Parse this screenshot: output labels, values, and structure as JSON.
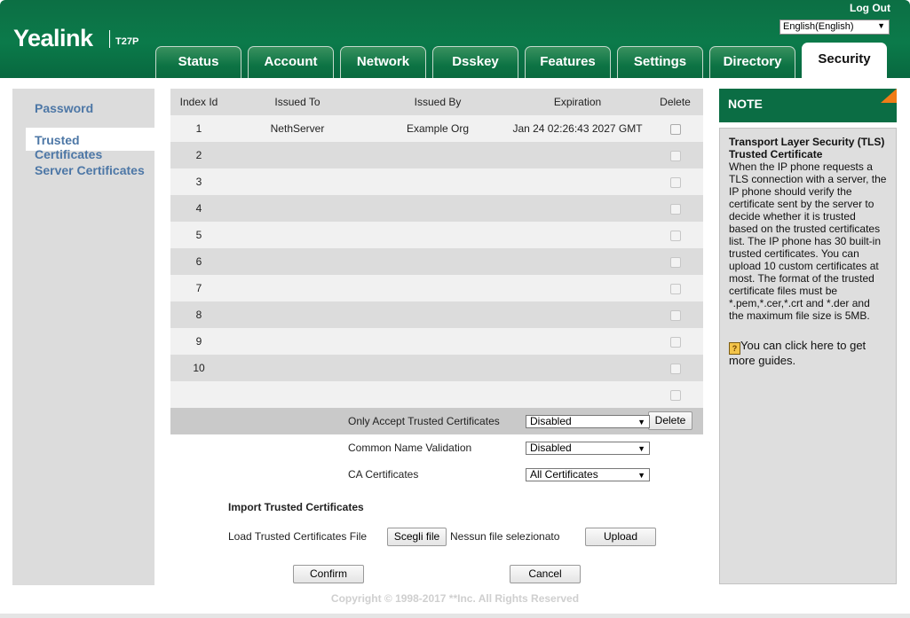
{
  "header": {
    "logo": "Yealink",
    "model": "T27P",
    "logout": "Log Out",
    "language": "English(English)"
  },
  "tabs": [
    {
      "label": "Status"
    },
    {
      "label": "Account"
    },
    {
      "label": "Network"
    },
    {
      "label": "Dsskey"
    },
    {
      "label": "Features"
    },
    {
      "label": "Settings"
    },
    {
      "label": "Directory"
    },
    {
      "label": "Security",
      "active": true
    }
  ],
  "sidebar": {
    "items": [
      {
        "label": "Password"
      },
      {
        "label": "Trusted Certificates",
        "active": true
      },
      {
        "label": "Server Certificates"
      }
    ]
  },
  "table": {
    "headers": {
      "index": "Index Id",
      "issued_to": "Issued To",
      "issued_by": "Issued By",
      "expiration": "Expiration",
      "delete": "Delete"
    },
    "rows": [
      {
        "index": "1",
        "issued_to": "NethServer",
        "issued_by": "Example Org",
        "expiration": "Jan 24 02:26:43 2027 GMT"
      },
      {
        "index": "2",
        "issued_to": "",
        "issued_by": "",
        "expiration": ""
      },
      {
        "index": "3",
        "issued_to": "",
        "issued_by": "",
        "expiration": ""
      },
      {
        "index": "4",
        "issued_to": "",
        "issued_by": "",
        "expiration": ""
      },
      {
        "index": "5",
        "issued_to": "",
        "issued_by": "",
        "expiration": ""
      },
      {
        "index": "6",
        "issued_to": "",
        "issued_by": "",
        "expiration": ""
      },
      {
        "index": "7",
        "issued_to": "",
        "issued_by": "",
        "expiration": ""
      },
      {
        "index": "8",
        "issued_to": "",
        "issued_by": "",
        "expiration": ""
      },
      {
        "index": "9",
        "issued_to": "",
        "issued_by": "",
        "expiration": ""
      },
      {
        "index": "10",
        "issued_to": "",
        "issued_by": "",
        "expiration": ""
      }
    ],
    "delete_button": "Delete"
  },
  "options": {
    "only_accept_label": "Only Accept Trusted Certificates",
    "only_accept_value": "Disabled",
    "cn_validation_label": "Common Name Validation",
    "cn_validation_value": "Disabled",
    "ca_label": "CA Certificates",
    "ca_value": "All Certificates"
  },
  "import": {
    "title": "Import Trusted Certificates",
    "load_label": "Load Trusted Certificates File",
    "choose_button": "Scegli file",
    "file_status": "Nessun file selezionato",
    "upload_button": "Upload"
  },
  "actions": {
    "confirm": "Confirm",
    "cancel": "Cancel"
  },
  "note": {
    "heading": "NOTE",
    "title": "Transport Layer Security (TLS) Trusted Certificate",
    "body": "When the IP phone requests a TLS connection with a server, the IP phone should verify the certificate sent by the server to decide whether it is trusted based on the trusted certificates list. The IP phone has 30 built-in trusted certificates. You can upload 10 custom certificates at most. The format of the trusted certificate files must be *.pem,*.cer,*.crt and *.der and the maximum file size is 5MB.",
    "guide": "You can click here to get more guides.",
    "help_icon_glyph": "?"
  },
  "footer": {
    "copyright": "Copyright © 1998-2017 **Inc. All Rights Reserved"
  },
  "colors": {
    "brand_green": "#0b7a4a",
    "note_accent": "#f07c17",
    "sidebar_link": "#4d77a6"
  }
}
